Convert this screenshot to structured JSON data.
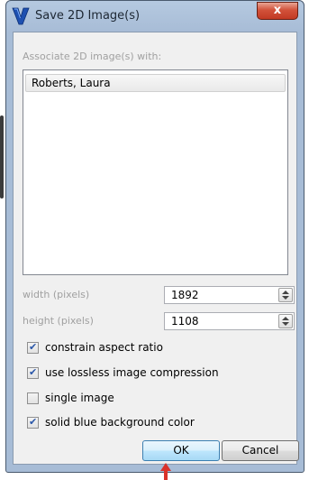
{
  "window": {
    "title": "Save 2D Image(s)"
  },
  "titlebar": {
    "close_glyph": "x"
  },
  "form": {
    "associate_label": "Associate 2D image(s) with:",
    "list_items": [
      "Roberts, Laura"
    ],
    "width_label": "width (pixels)",
    "width_value": "1892",
    "height_label": "height (pixels)",
    "height_value": "1108"
  },
  "options": [
    {
      "label": "constrain aspect ratio",
      "checked": true
    },
    {
      "label": "use lossless image compression",
      "checked": true
    },
    {
      "label": "single image",
      "checked": false
    },
    {
      "label": "solid blue background color",
      "checked": true
    }
  ],
  "buttons": {
    "ok_label": "OK",
    "cancel_label": "Cancel"
  },
  "colors": {
    "accent": "#3c7fb1",
    "close": "#c23a24",
    "cursor": "#d9322a"
  },
  "icons": {
    "app": "v-logo-icon",
    "cursor": "arrow-pointer-icon"
  }
}
